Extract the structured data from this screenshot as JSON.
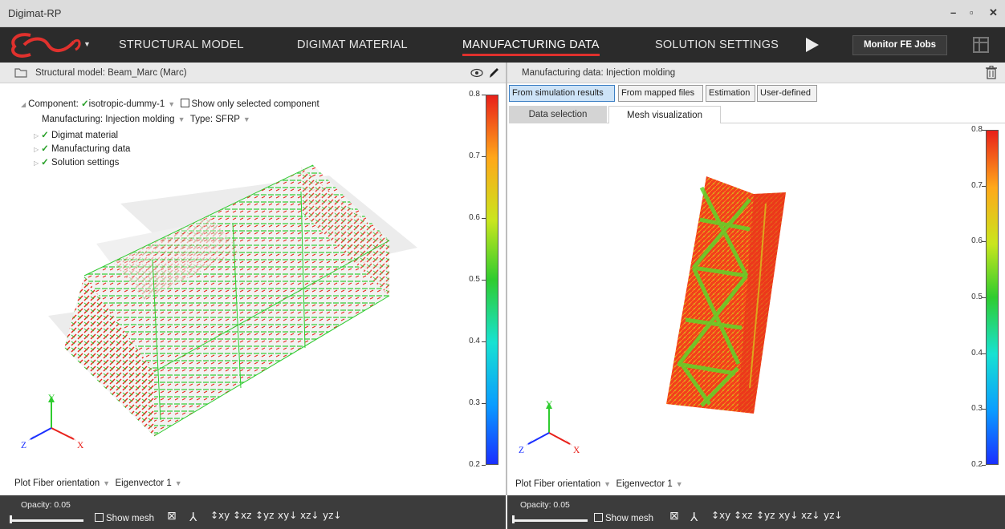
{
  "window": {
    "title": "Digimat-RP",
    "minimize": "–",
    "maximize": "▫",
    "close": "✕"
  },
  "nav": {
    "tabs": [
      "STRUCTURAL MODEL",
      "DIGIMAT MATERIAL",
      "MANUFACTURING DATA",
      "SOLUTION SETTINGS"
    ],
    "active_tab": "MANUFACTURING DATA",
    "monitor_button": "Monitor FE Jobs",
    "accent": "#e0312d"
  },
  "left": {
    "header": "Structural model: Beam_Marc (Marc)",
    "component_label": "Component:",
    "component_value": "isotropic-dummy-1",
    "show_only_selected": "Show only selected component",
    "manufacturing_label": "Manufacturing:",
    "manufacturing_value": "Injection molding",
    "type_label": "Type:",
    "type_value": "SFRP",
    "tree_items": [
      "Digimat material",
      "Manufacturing data",
      "Solution settings"
    ],
    "plot_label": "Plot",
    "plot_value": "Fiber orientation",
    "eigen_value": "Eigenvector 1",
    "opacity": "Opacity: 0.05",
    "show_mesh": "Show mesh",
    "view_buttons": [
      "↕xy",
      "↕xz",
      "↕yz",
      "xy↓",
      "xz↓",
      "yz↓"
    ],
    "colorbar_ticks": [
      "0.8",
      "0.7",
      "0.6",
      "0.5",
      "0.4",
      "0.3",
      "0.2"
    ],
    "axes": {
      "x": "X",
      "y": "Y",
      "z": "Z"
    }
  },
  "right": {
    "header": "Manufacturing data: Injection molding",
    "source_buttons": [
      "From simulation results",
      "From mapped files",
      "Estimation",
      "User-defined"
    ],
    "selected_source": "From simulation results",
    "subtabs": [
      "Data selection",
      "Mesh visualization"
    ],
    "active_subtab": "Mesh visualization",
    "plot_label": "Plot",
    "plot_value": "Fiber orientation",
    "eigen_value": "Eigenvector 1",
    "opacity": "Opacity: 0.05",
    "show_mesh": "Show mesh",
    "view_buttons": [
      "↕xy",
      "↕xz",
      "↕yz",
      "xy↓",
      "xz↓",
      "yz↓"
    ],
    "colorbar_ticks": [
      "0.8",
      "0.7",
      "0.6",
      "0.5",
      "0.4",
      "0.3",
      "0.2"
    ],
    "axes": {
      "x": "X",
      "y": "Y",
      "z": "Z"
    }
  },
  "colormap": {
    "min": 0.2,
    "max": 0.8,
    "colors": [
      "#1a2fff",
      "#0a9cff",
      "#18e2d2",
      "#2fcc2f",
      "#c9e61e",
      "#ffa81a",
      "#e8201a"
    ]
  },
  "icons": [
    "folder-icon",
    "eye-icon",
    "pencil-icon",
    "trash-icon",
    "play-icon",
    "grid-icon",
    "fit-view-icon",
    "axes-view-icon"
  ]
}
